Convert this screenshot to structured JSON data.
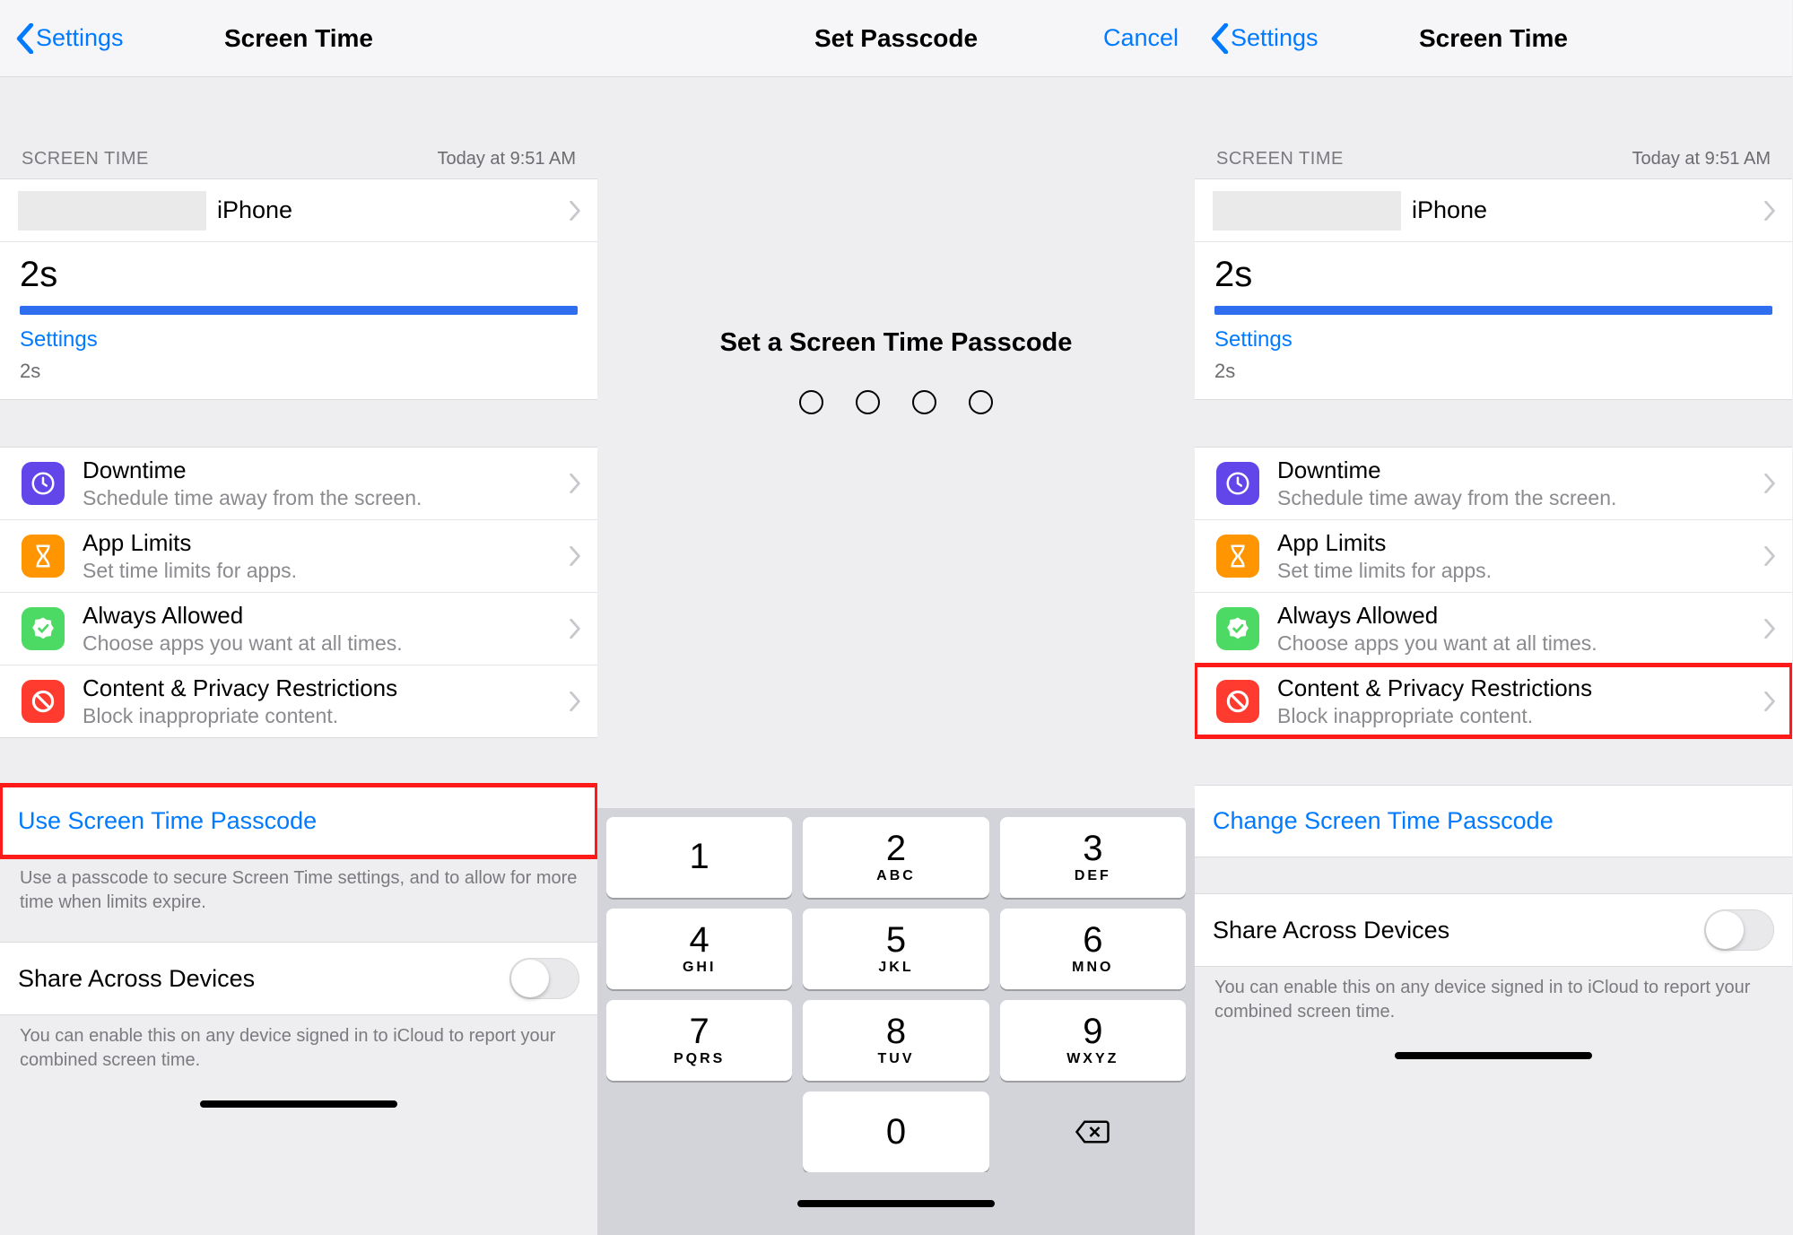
{
  "panes": {
    "left": {
      "nav": {
        "back": "Settings",
        "title": "Screen Time"
      },
      "section": {
        "label": "SCREEN TIME",
        "timestamp": "Today at 9:51 AM"
      },
      "summary": {
        "device": "iPhone",
        "duration": "2s",
        "category_label": "Settings",
        "category_time": "2s"
      },
      "options": [
        {
          "title": "Downtime",
          "subtitle": "Schedule time away from the screen.",
          "icon": "clock-icon",
          "color": "purple"
        },
        {
          "title": "App Limits",
          "subtitle": "Set time limits for apps.",
          "icon": "hourglass-icon",
          "color": "orange"
        },
        {
          "title": "Always Allowed",
          "subtitle": "Choose apps you want at all times.",
          "icon": "check-badge-icon",
          "color": "green"
        },
        {
          "title": "Content & Privacy Restrictions",
          "subtitle": "Block inappropriate content.",
          "icon": "no-entry-icon",
          "color": "red"
        }
      ],
      "passcode_action": "Use Screen Time Passcode",
      "passcode_footer": "Use a passcode to secure Screen Time settings, and to allow for more time when limits expire.",
      "share": {
        "label": "Share Across Devices",
        "footer": "You can enable this on any device signed in to iCloud to report your combined screen time."
      }
    },
    "middle": {
      "nav": {
        "title": "Set Passcode",
        "cancel": "Cancel"
      },
      "heading": "Set a Screen Time Passcode",
      "keypad": [
        {
          "n": "1",
          "l": ""
        },
        {
          "n": "2",
          "l": "ABC"
        },
        {
          "n": "3",
          "l": "DEF"
        },
        {
          "n": "4",
          "l": "GHI"
        },
        {
          "n": "5",
          "l": "JKL"
        },
        {
          "n": "6",
          "l": "MNO"
        },
        {
          "n": "7",
          "l": "PQRS"
        },
        {
          "n": "8",
          "l": "TUV"
        },
        {
          "n": "9",
          "l": "WXYZ"
        }
      ],
      "zero": "0"
    },
    "right": {
      "nav": {
        "back": "Settings",
        "title": "Screen Time"
      },
      "section": {
        "label": "SCREEN TIME",
        "timestamp": "Today at 9:51 AM"
      },
      "summary": {
        "device": "iPhone",
        "duration": "2s",
        "category_label": "Settings",
        "category_time": "2s"
      },
      "options": [
        {
          "title": "Downtime",
          "subtitle": "Schedule time away from the screen.",
          "icon": "clock-icon",
          "color": "purple"
        },
        {
          "title": "App Limits",
          "subtitle": "Set time limits for apps.",
          "icon": "hourglass-icon",
          "color": "orange"
        },
        {
          "title": "Always Allowed",
          "subtitle": "Choose apps you want at all times.",
          "icon": "check-badge-icon",
          "color": "green"
        },
        {
          "title": "Content & Privacy Restrictions",
          "subtitle": "Block inappropriate content.",
          "icon": "no-entry-icon",
          "color": "red"
        }
      ],
      "passcode_action": "Change Screen Time Passcode",
      "share": {
        "label": "Share Across Devices",
        "footer": "You can enable this on any device signed in to iCloud to report your combined screen time."
      }
    }
  }
}
